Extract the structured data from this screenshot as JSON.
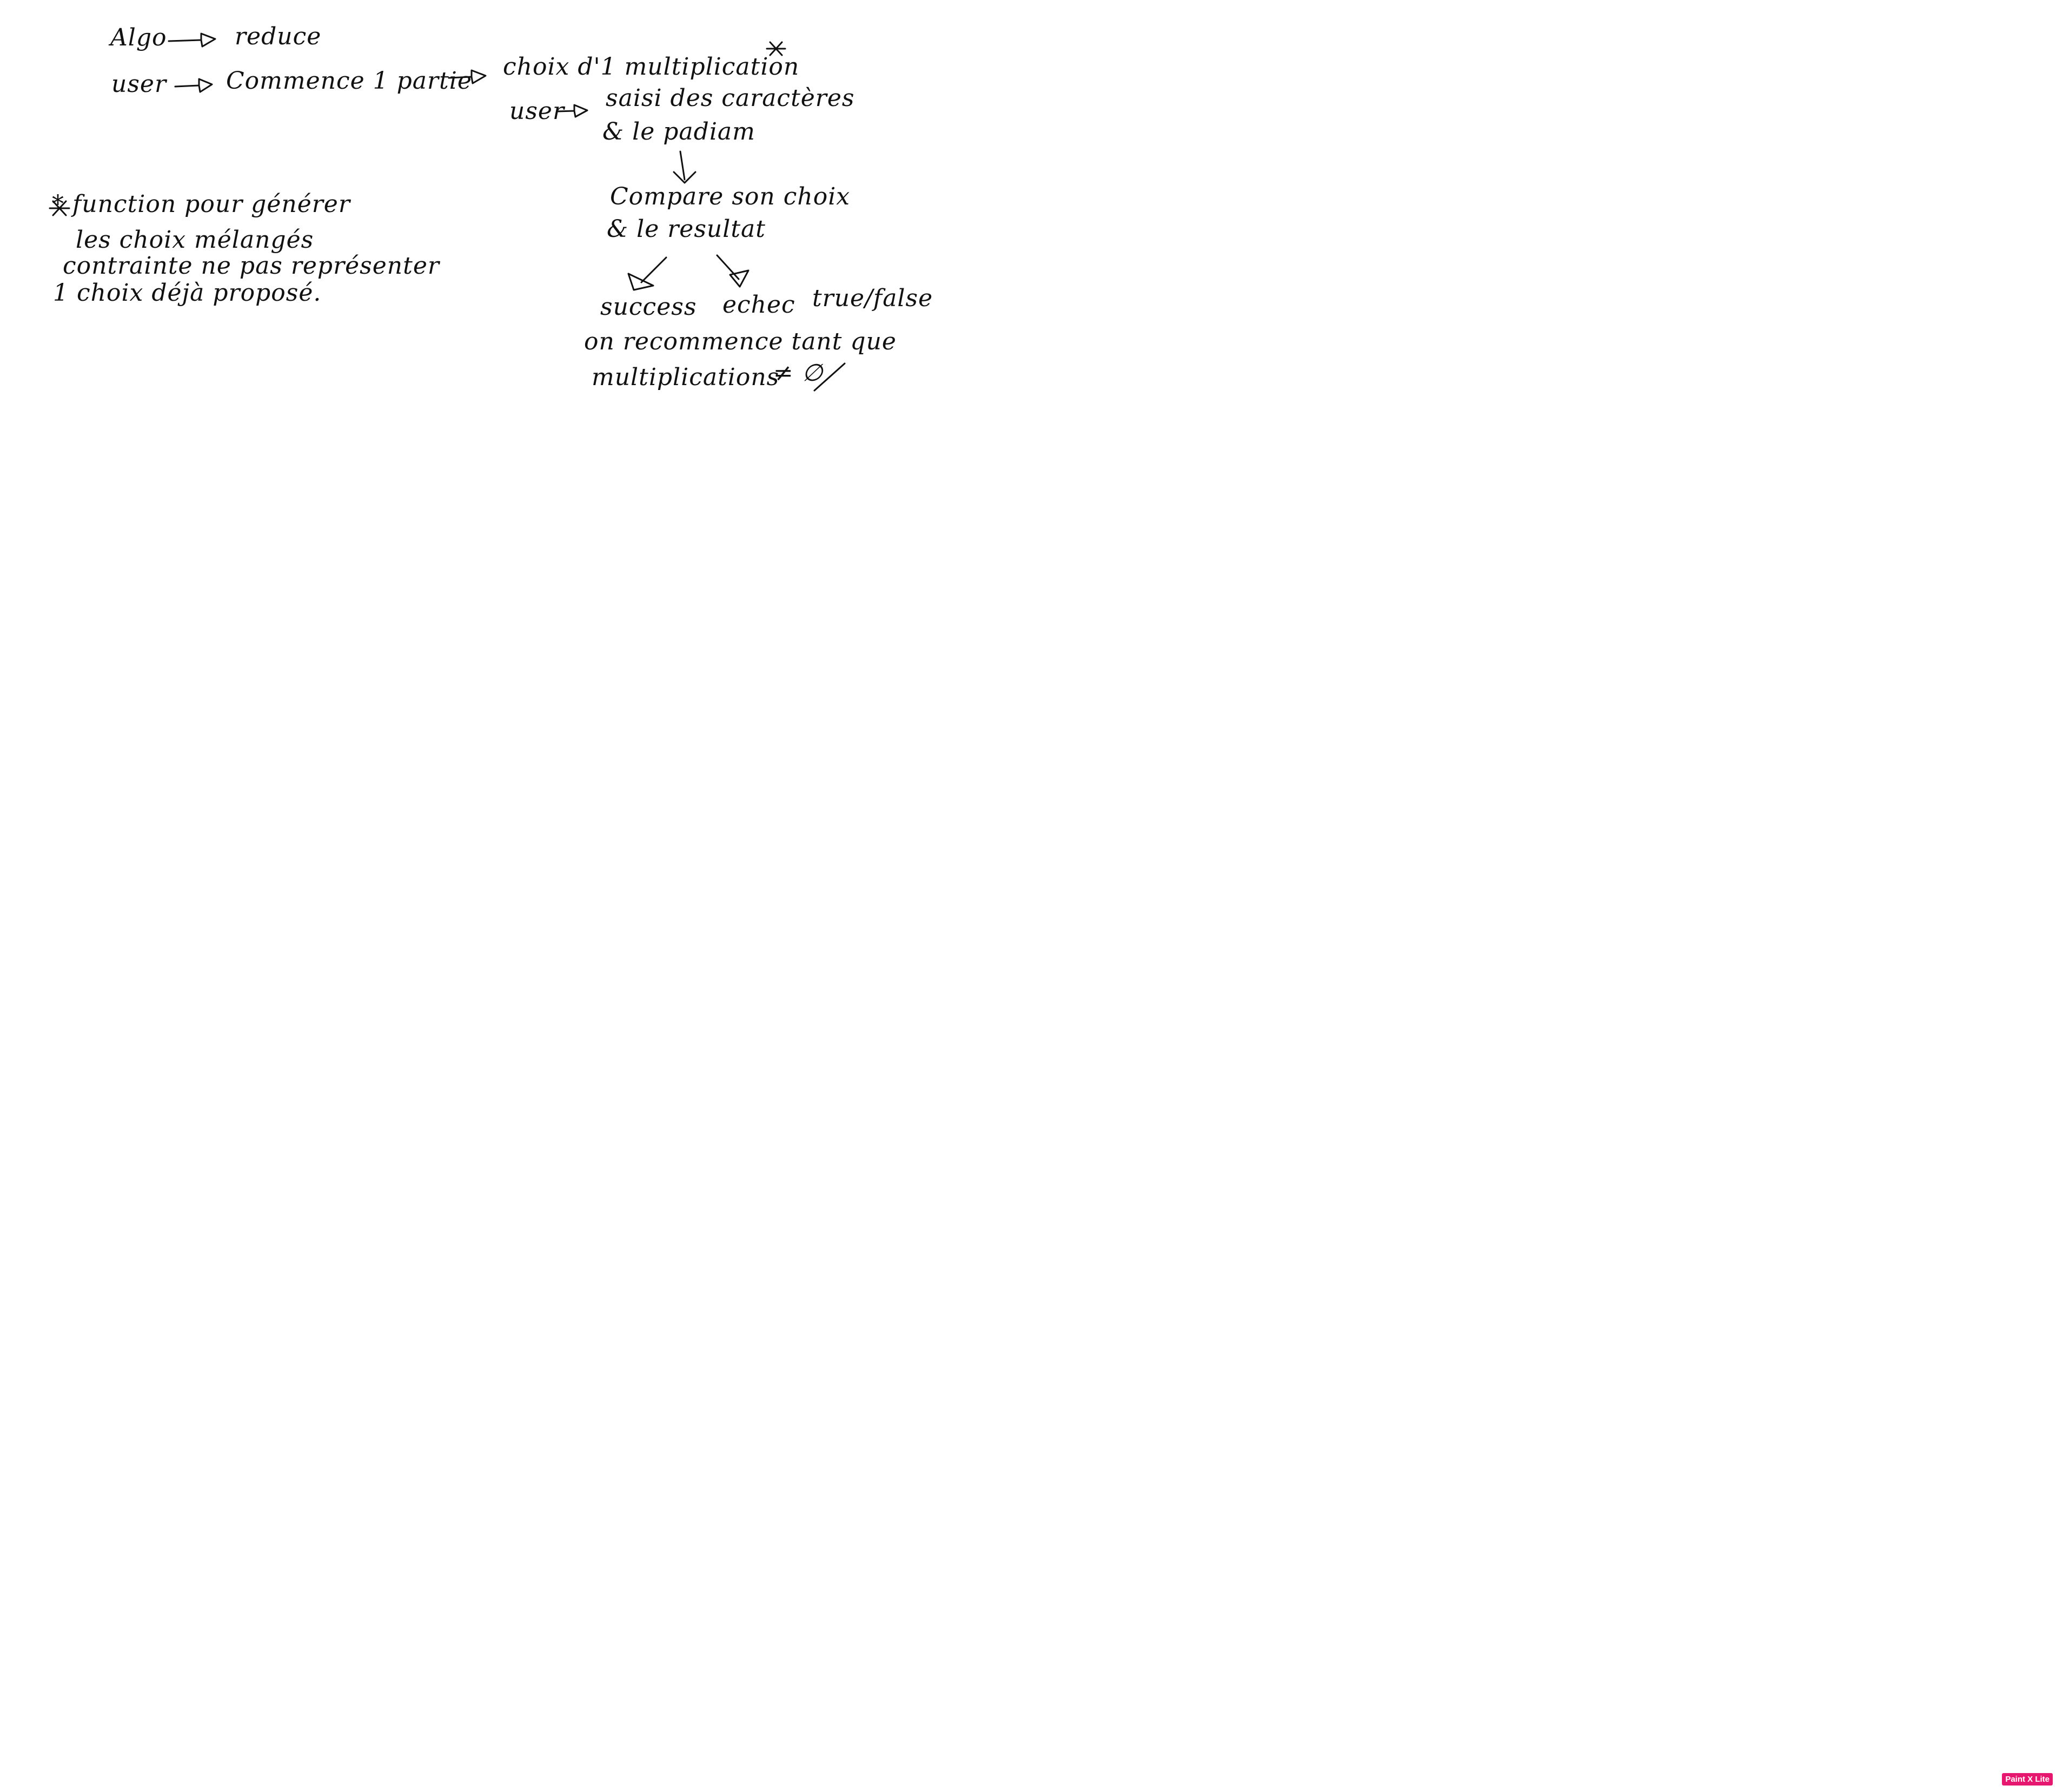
{
  "canvas": {
    "background": "#ffffff",
    "ink_color": "#111111"
  },
  "notes": {
    "algo": "Algo",
    "reduce": "reduce",
    "user": "user",
    "commence": "Commence 1 partie",
    "choix": "choix d'1 multiplication",
    "star_mark": "*",
    "user2": "user",
    "saisi": "saisi des caractères",
    "padiam": "& le padiam",
    "compare": "Compare son choix",
    "resultat": "& le resultat",
    "success": "success",
    "echec": "echec",
    "true_false": "true/false",
    "recommence": "on recommence tant que",
    "multiplications": "multiplications",
    "not_equal_empty": "≠ ∅",
    "footnote_line1": "* function pour générer",
    "footnote_line2": "les choix mélangés",
    "footnote_line3": "contrainte ne pas représenter",
    "footnote_line4": "1 choix déjà proposé."
  },
  "badge": {
    "label": "Paint X Lite",
    "color": "#e6176f"
  }
}
